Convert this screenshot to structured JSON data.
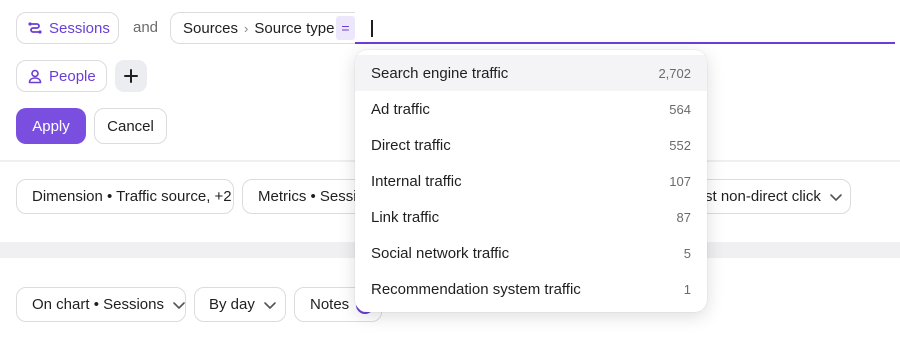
{
  "segment": {
    "sessions_label": "Sessions",
    "and_label": "and",
    "people_label": "People"
  },
  "filter": {
    "path_part1": "Sources",
    "separator": "›",
    "path_part2": "Source type",
    "operator": "=",
    "value": ""
  },
  "actions": {
    "apply_label": "Apply",
    "cancel_label": "Cancel"
  },
  "report_controls": {
    "dimension_label": "Dimension • Traffic source, +2",
    "metrics_label": "Metrics • Sessions",
    "attribution_label": "st non-direct click"
  },
  "chart_controls": {
    "on_chart_label": "On chart • Sessions",
    "by_day_label": "By day",
    "notes_label": "Notes"
  },
  "dropdown": {
    "items": [
      {
        "label": "Search engine traffic",
        "count": "2,702"
      },
      {
        "label": "Ad traffic",
        "count": "564"
      },
      {
        "label": "Direct traffic",
        "count": "552"
      },
      {
        "label": "Internal traffic",
        "count": "107"
      },
      {
        "label": "Link traffic",
        "count": "87"
      },
      {
        "label": "Social network traffic",
        "count": "5"
      },
      {
        "label": "Recommendation system traffic",
        "count": "1"
      }
    ]
  },
  "colors": {
    "accent": "#7a4fe0",
    "accent_text": "#6b3fd6"
  }
}
